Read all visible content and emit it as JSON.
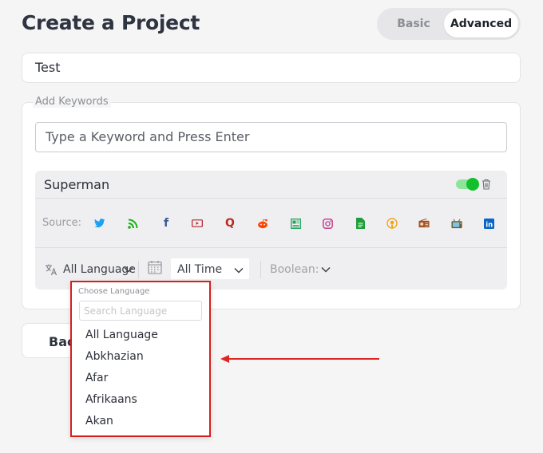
{
  "header": {
    "title": "Create a Project",
    "mode_basic": "Basic",
    "mode_advanced": "Advanced"
  },
  "project_name": "Test",
  "keywords": {
    "legend": "Add Keywords",
    "input_placeholder": "Type a Keyword and Press Enter",
    "items": [
      {
        "name": "Superman",
        "enabled": true,
        "source_label": "Source:",
        "sources": [
          {
            "icon": "twitter-icon",
            "color": "#1da1f2"
          },
          {
            "icon": "rss-icon",
            "color": "#16b216"
          },
          {
            "icon": "facebook-icon",
            "color": "#3b5998"
          },
          {
            "icon": "youtube-icon",
            "color": "#b3262c"
          },
          {
            "icon": "quora-icon",
            "color": "#b92b27"
          },
          {
            "icon": "reddit-icon",
            "color": "#ff4500"
          },
          {
            "icon": "news-icon",
            "color": "#1ea45a"
          },
          {
            "icon": "instagram-icon",
            "color": "#c13584"
          },
          {
            "icon": "document-icon",
            "color": "#1e9e3a"
          },
          {
            "icon": "podcast-icon",
            "color": "#f2a51a"
          },
          {
            "icon": "radio-icon",
            "color": "#a0522d"
          },
          {
            "icon": "tv-icon",
            "color": "#6b5b2e"
          },
          {
            "icon": "linkedin-icon",
            "color": "#0a66c2"
          }
        ]
      }
    ],
    "filters": {
      "language": "All Language",
      "time": "All Time",
      "boolean_label": "Boolean:"
    }
  },
  "back_button": "Back",
  "language_dropdown": {
    "heading": "Choose Language",
    "search_placeholder": "Search Language",
    "options": [
      "All Language",
      "Abkhazian",
      "Afar",
      "Afrikaans",
      "Akan"
    ]
  },
  "colors": {
    "toggle_on": "#11c02b",
    "highlight_border": "#d61f1f",
    "annotation_arrow": "#e02525"
  }
}
